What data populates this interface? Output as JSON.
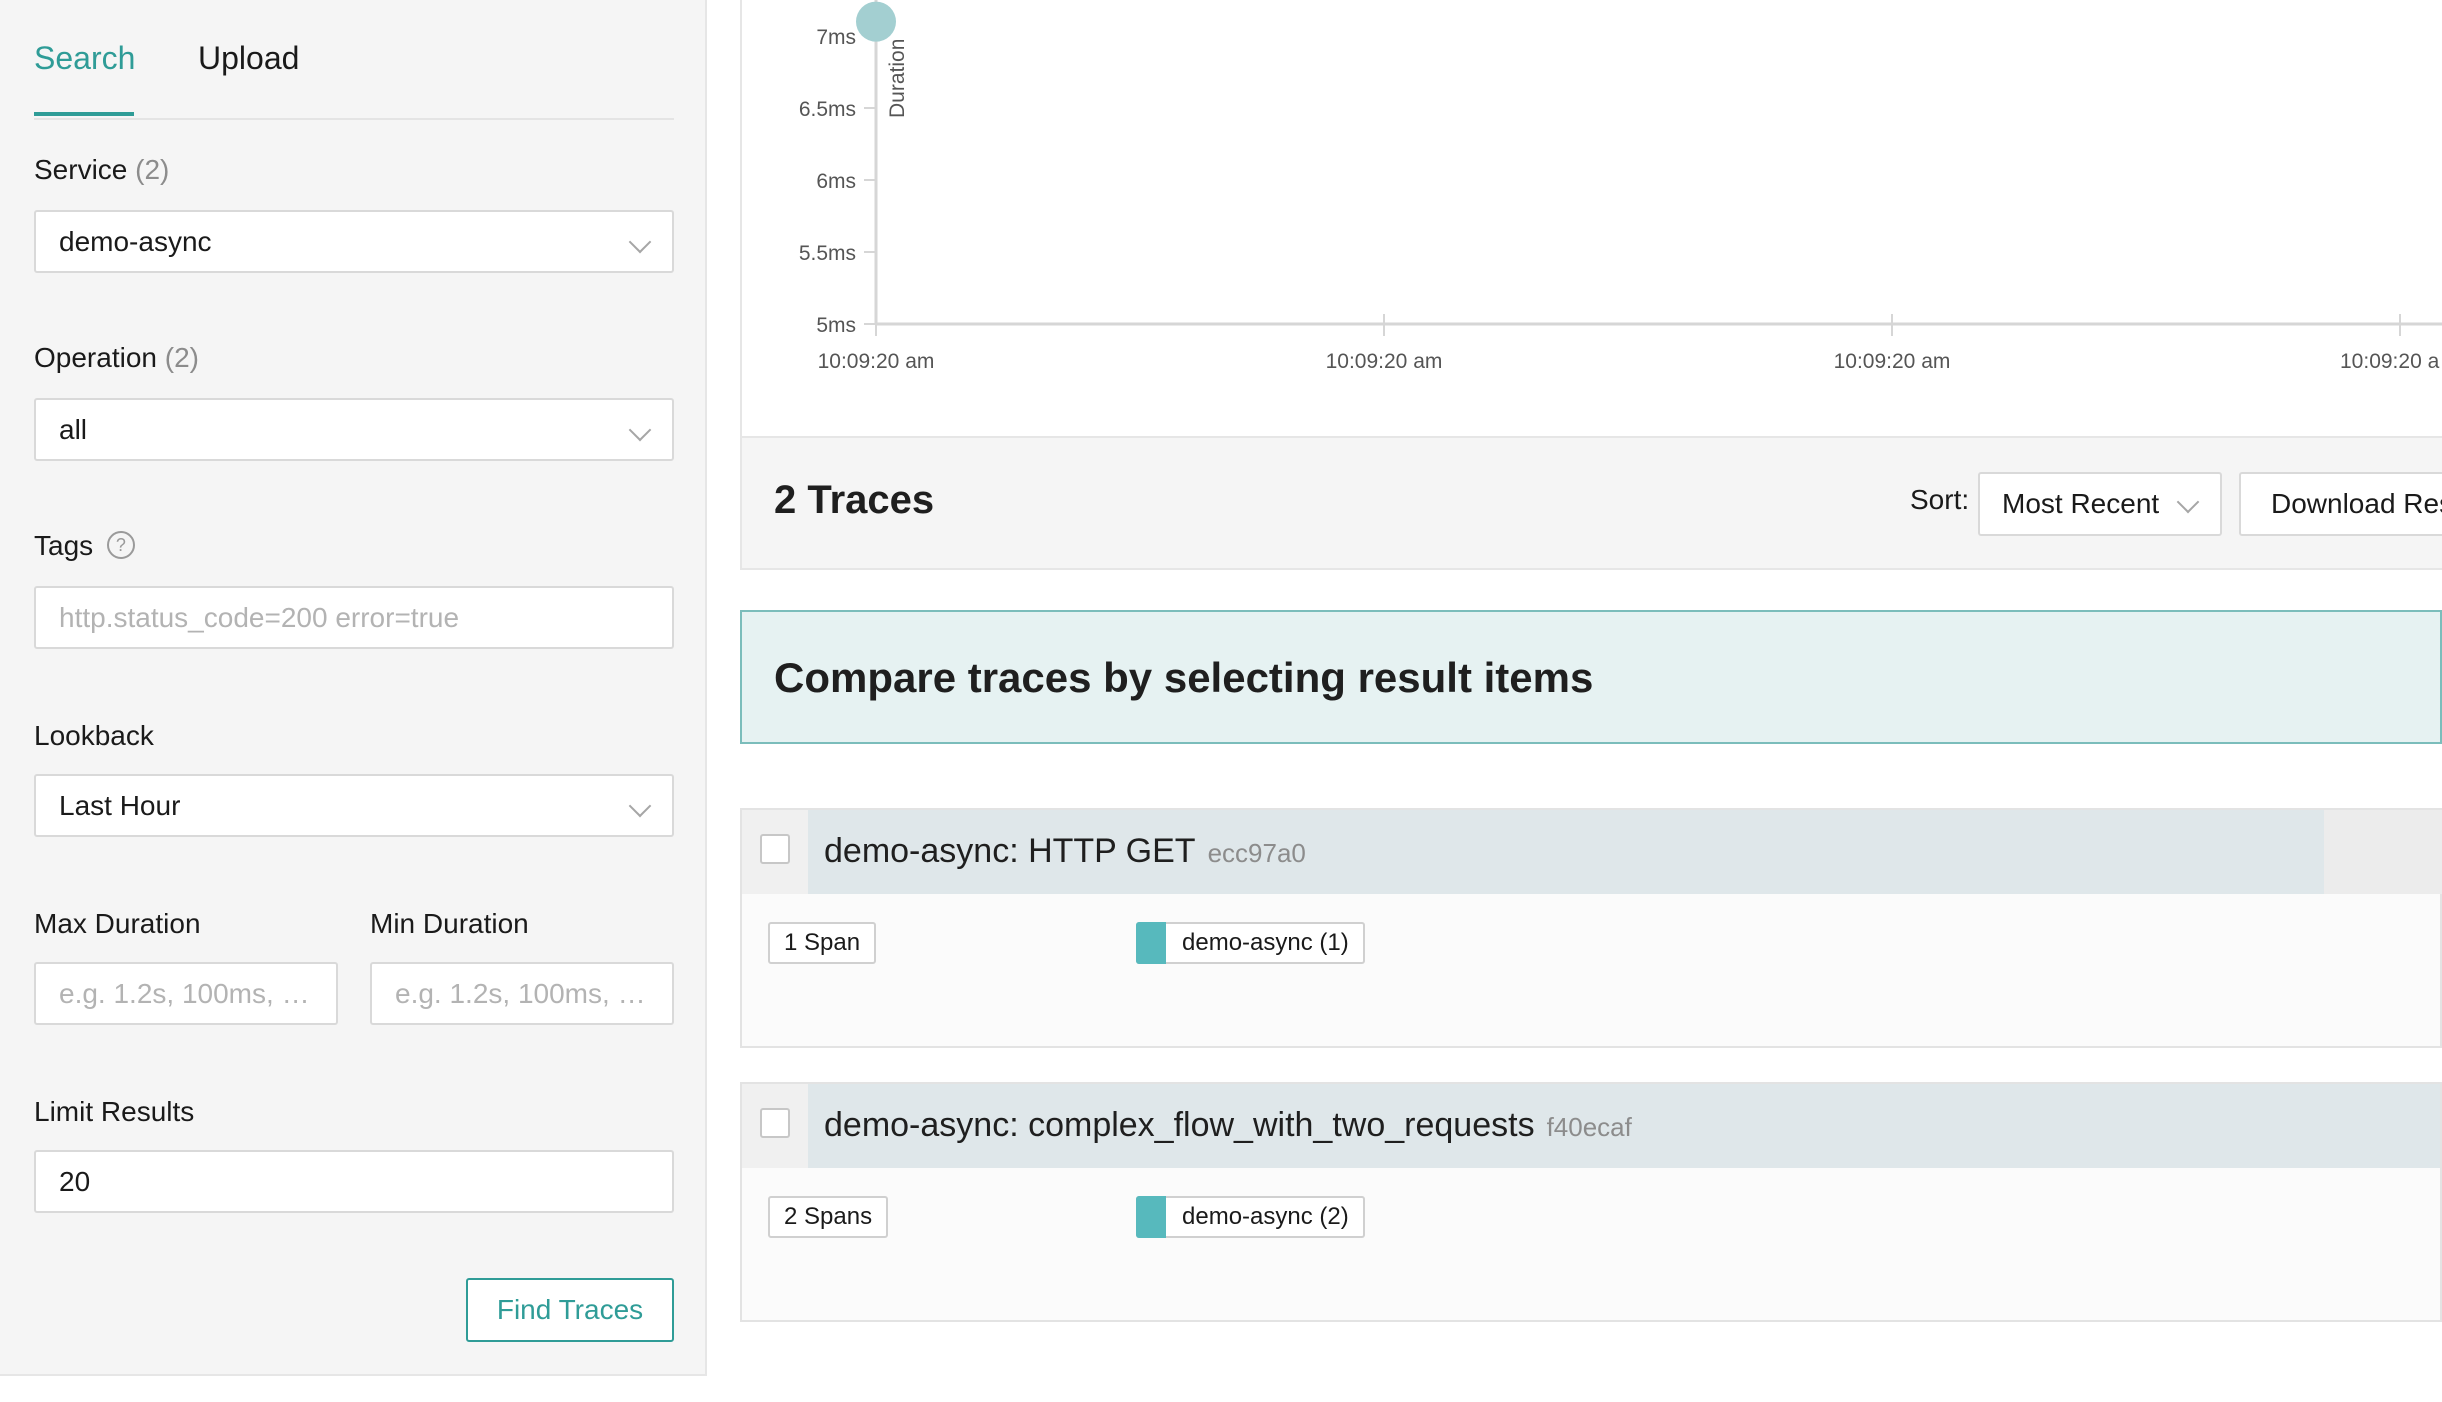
{
  "sidebar": {
    "tabs": [
      {
        "label": "Search"
      },
      {
        "label": "Upload"
      }
    ],
    "service": {
      "label": "Service",
      "count": "(2)",
      "value": "demo-async"
    },
    "operation": {
      "label": "Operation",
      "count": "(2)",
      "value": "all"
    },
    "tags": {
      "label": "Tags",
      "help_glyph": "?",
      "placeholder": "http.status_code=200 error=true"
    },
    "lookback": {
      "label": "Lookback",
      "value": "Last Hour"
    },
    "max_duration": {
      "label": "Max Duration",
      "placeholder": "e.g. 1.2s, 100ms, …"
    },
    "min_duration": {
      "label": "Min Duration",
      "placeholder": "e.g. 1.2s, 100ms, …"
    },
    "limit": {
      "label": "Limit Results",
      "value": "20"
    },
    "find_button": "Find Traces"
  },
  "chart_data": {
    "type": "scatter",
    "ylabel": "Duration",
    "y_ticks": [
      "5ms",
      "5.5ms",
      "6ms",
      "6.5ms",
      "7ms"
    ],
    "ylim": [
      5,
      7.1
    ],
    "x_ticks": [
      "10:09:20 am",
      "10:09:20 am",
      "10:09:20 am",
      "10:09:20 a"
    ],
    "points": [
      {
        "x_tick_index": 0,
        "y": 7.1
      }
    ],
    "grid": false,
    "point_color": "#a3cfd1"
  },
  "results": {
    "count_title": "2 Traces",
    "sort_label": "Sort:",
    "sort_value": "Most Recent",
    "download_label": "Download Res",
    "compare_text": "Compare traces by selecting result items",
    "traces": [
      {
        "name": "demo-async: HTTP GET",
        "id": "ecc97a0",
        "spans": "1 Span",
        "service": "demo-async (1)"
      },
      {
        "name": "demo-async: complex_flow_with_two_requests",
        "id": "f40ecaf",
        "spans": "2 Spans",
        "service": "demo-async (2)"
      }
    ]
  },
  "colors": {
    "accent": "#2f9c97",
    "service": "#57b9bd",
    "compare_bg": "#e6f2f2"
  }
}
